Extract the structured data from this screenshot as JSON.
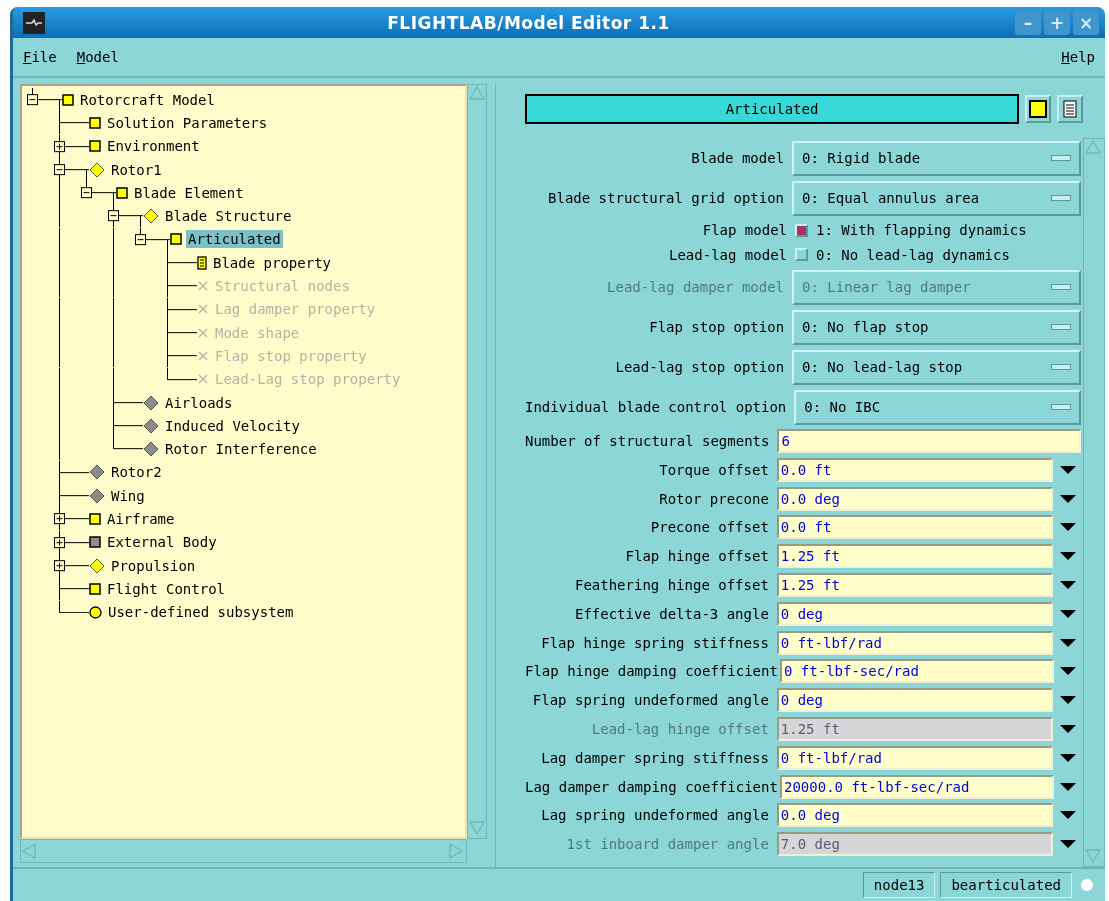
{
  "window": {
    "title": "FLIGHTLAB/Model Editor 1.1",
    "controls": [
      "–",
      "+",
      "×"
    ]
  },
  "menu": {
    "left": [
      {
        "label": "File"
      },
      {
        "label": "Model"
      }
    ],
    "right": [
      {
        "label": "Help"
      }
    ]
  },
  "tree": [
    {
      "label": "Rotorcraft Model",
      "kind": "square",
      "color": "#ffff00",
      "expanded": true,
      "selected": false,
      "children": [
        {
          "label": "Solution Parameters",
          "kind": "square",
          "color": "#ffff00",
          "selected": false
        },
        {
          "label": "Environment",
          "kind": "square",
          "color": "#ffff00",
          "expanded": false,
          "selected": false
        },
        {
          "label": "Rotor1",
          "kind": "diamond",
          "color": "#ffff00",
          "expanded": true,
          "selected": false,
          "children": [
            {
              "label": "Blade Element",
              "kind": "square",
              "color": "#ffff00",
              "expanded": true,
              "selected": false,
              "children": [
                {
                  "label": "Blade Structure",
                  "kind": "diamond",
                  "color": "#ffff00",
                  "expanded": true,
                  "selected": false,
                  "children": [
                    {
                      "label": "Articulated",
                      "kind": "square",
                      "color": "#ffff00",
                      "expanded": true,
                      "selected": true,
                      "children": [
                        {
                          "label": "Blade property",
                          "kind": "sheet",
                          "color": "#ffff00",
                          "selected": false,
                          "disabled": false
                        },
                        {
                          "label": "Structural nodes",
                          "kind": "cross",
                          "selected": false,
                          "disabled": true
                        },
                        {
                          "label": "Lag damper property",
                          "kind": "cross",
                          "selected": false,
                          "disabled": true
                        },
                        {
                          "label": "Mode shape",
                          "kind": "cross",
                          "selected": false,
                          "disabled": true
                        },
                        {
                          "label": "Flap stop property",
                          "kind": "cross",
                          "selected": false,
                          "disabled": true
                        },
                        {
                          "label": "Lead-Lag stop property",
                          "kind": "cross",
                          "selected": false,
                          "disabled": true
                        }
                      ]
                    }
                  ]
                },
                {
                  "label": "Airloads",
                  "kind": "diamond",
                  "color": "#8c8c8c",
                  "selected": false
                },
                {
                  "label": "Induced Velocity",
                  "kind": "diamond",
                  "color": "#8c8c8c",
                  "selected": false
                },
                {
                  "label": "Rotor Interference",
                  "kind": "diamond",
                  "color": "#8c8c8c",
                  "selected": false
                }
              ]
            }
          ]
        },
        {
          "label": "Rotor2",
          "kind": "diamond",
          "color": "#8c8c8c",
          "selected": false
        },
        {
          "label": "Wing",
          "kind": "diamond",
          "color": "#8c8c8c",
          "selected": false
        },
        {
          "label": "Airframe",
          "kind": "square",
          "color": "#ffff00",
          "expanded": false,
          "selected": false
        },
        {
          "label": "External Body",
          "kind": "square",
          "color": "#8c8c8c",
          "expanded": false,
          "selected": false
        },
        {
          "label": "Propulsion",
          "kind": "diamond",
          "color": "#ffff00",
          "expanded": false,
          "selected": false
        },
        {
          "label": "Flight Control",
          "kind": "square",
          "color": "#ffff00",
          "selected": false
        },
        {
          "label": "User-defined subsystem",
          "kind": "circle",
          "color": "#ffff00",
          "selected": false
        }
      ]
    }
  ],
  "editor": {
    "title": "Articulated",
    "fields": [
      {
        "kind": "select",
        "label": "Blade model",
        "value": "0: Rigid blade",
        "disabled": false
      },
      {
        "kind": "select",
        "label": "Blade structural grid option",
        "value": "0: Equal annulus area",
        "disabled": false
      },
      {
        "kind": "check",
        "label": "Flap model",
        "value": "1: With flapping dynamics",
        "checked": true
      },
      {
        "kind": "check",
        "label": "Lead-lag model",
        "value": "0: No lead-lag dynamics",
        "checked": false
      },
      {
        "kind": "select",
        "label": "Lead-lag damper model",
        "value": "0: Linear lag damper",
        "disabled": true
      },
      {
        "kind": "select",
        "label": "Flap stop option",
        "value": "0: No flap stop",
        "disabled": false
      },
      {
        "kind": "select",
        "label": "Lead-lag stop option",
        "value": "0: No lead-lag stop",
        "disabled": false
      },
      {
        "kind": "select",
        "label": "Individual blade control option",
        "value": "0: No IBC",
        "disabled": false
      },
      {
        "kind": "text",
        "label": "Number of structural segments",
        "value": "6",
        "disabled": false
      },
      {
        "kind": "unit",
        "label": "Torque offset",
        "value": "0.0 ft",
        "disabled": false
      },
      {
        "kind": "unit",
        "label": "Rotor precone",
        "value": "0.0 deg",
        "disabled": false
      },
      {
        "kind": "unit",
        "label": "Precone offset",
        "value": "0.0 ft",
        "disabled": false
      },
      {
        "kind": "unit",
        "label": "Flap hinge offset",
        "value": "1.25 ft",
        "disabled": false
      },
      {
        "kind": "unit",
        "label": "Feathering hinge offset",
        "value": "1.25 ft",
        "disabled": false
      },
      {
        "kind": "unit",
        "label": "Effective delta-3 angle",
        "value": "0 deg",
        "disabled": false
      },
      {
        "kind": "unit",
        "label": "Flap hinge spring stiffness",
        "value": "0 ft-lbf/rad",
        "disabled": false
      },
      {
        "kind": "unit",
        "label": "Flap hinge damping coefficient",
        "value": "0 ft-lbf-sec/rad",
        "disabled": false
      },
      {
        "kind": "unit",
        "label": "Flap spring undeformed angle",
        "value": "0 deg",
        "disabled": false
      },
      {
        "kind": "unit",
        "label": "Lead-lag hinge offset",
        "value": "1.25 ft",
        "disabled": true
      },
      {
        "kind": "unit",
        "label": "Lag damper spring stiffness",
        "value": "0 ft-lbf/rad",
        "disabled": false
      },
      {
        "kind": "unit",
        "label": "Lag damper damping coefficient",
        "value": "20000.0 ft-lbf-sec/rad",
        "disabled": false
      },
      {
        "kind": "unit",
        "label": "Lag spring undeformed angle",
        "value": "0.0 deg",
        "disabled": false
      },
      {
        "kind": "unit",
        "label": "1st inboard damper angle",
        "value": "7.0 deg",
        "disabled": true
      }
    ]
  },
  "status_bar": [
    "node13",
    "bearticulated"
  ]
}
